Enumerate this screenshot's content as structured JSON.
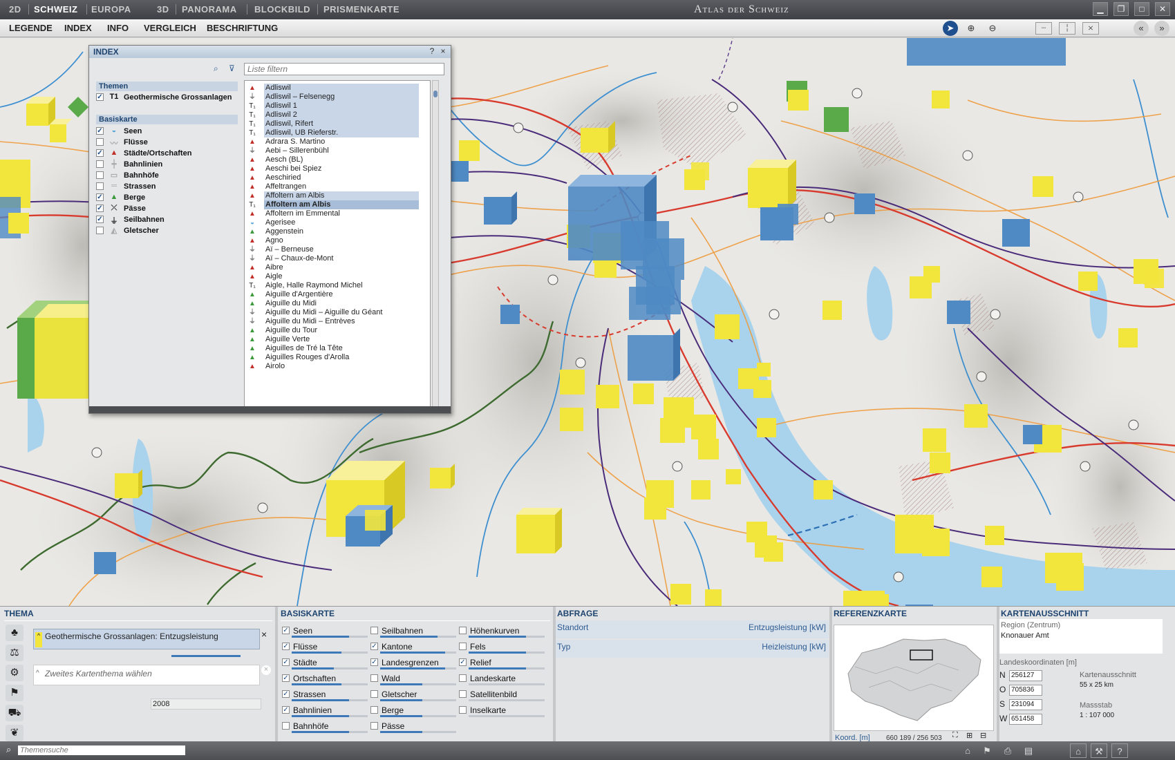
{
  "window": {
    "title": "Atlas der Schweiz",
    "view_tabs": [
      {
        "label": "2D",
        "active": false
      },
      {
        "label": "SCHWEIZ",
        "active": true
      },
      {
        "label": "EUROPA",
        "active": false
      },
      {
        "label": "3D",
        "active": false
      },
      {
        "label": "PANORAMA",
        "active": false
      },
      {
        "label": "BLOCKBILD",
        "active": false
      },
      {
        "label": "PRISMENKARTE",
        "active": false
      }
    ],
    "controls": [
      "minimize-icon",
      "restore-icon",
      "maximize-icon",
      "close-icon"
    ]
  },
  "menu": {
    "items": [
      "LEGENDE",
      "INDEX",
      "INFO",
      "VERGLEICH",
      "BESCHRIFTUNG"
    ],
    "tools": [
      "pointer-icon",
      "zoom-in-icon",
      "zoom-out-icon"
    ],
    "view_tools": [
      "profile-icon",
      "split-view-icon",
      "compare-icon",
      "back-icon",
      "forward-icon"
    ]
  },
  "index_panel": {
    "title": "INDEX",
    "help": "?",
    "close": "×",
    "filter_placeholder": "Liste filtern",
    "themen_header": "Themen",
    "themen": [
      {
        "label": "Geothermische Grossanlagen",
        "checked": true,
        "icon": "T1"
      }
    ],
    "basiskarte_header": "Basiskarte",
    "layers": [
      {
        "label": "Seen",
        "checked": true,
        "icon": "lake-icon"
      },
      {
        "label": "Flüsse",
        "checked": false,
        "icon": "river-icon"
      },
      {
        "label": "Städte/Ortschaften",
        "checked": true,
        "icon": "town-icon"
      },
      {
        "label": "Bahnlinien",
        "checked": false,
        "icon": "rail-icon"
      },
      {
        "label": "Bahnhöfe",
        "checked": false,
        "icon": "station-icon"
      },
      {
        "label": "Strassen",
        "checked": false,
        "icon": "road-icon"
      },
      {
        "label": "Berge",
        "checked": true,
        "icon": "mountain-icon"
      },
      {
        "label": "Pässe",
        "checked": true,
        "icon": "pass-icon"
      },
      {
        "label": "Seilbahnen",
        "checked": true,
        "icon": "cablecar-icon"
      },
      {
        "label": "Gletscher",
        "checked": false,
        "icon": "glacier-icon"
      }
    ],
    "list": [
      {
        "label": "Adliswil",
        "icon": "town",
        "state": "sel"
      },
      {
        "label": "Adliswil – Felsenegg",
        "icon": "cable",
        "state": "sel"
      },
      {
        "label": "Adliswil 1",
        "icon": "T1",
        "state": "sel"
      },
      {
        "label": "Adliswil 2",
        "icon": "T1",
        "state": "sel"
      },
      {
        "label": "Adliswil, Rifert",
        "icon": "T1",
        "state": "sel"
      },
      {
        "label": "Adliswil, UB Rieferstr.",
        "icon": "T1",
        "state": "sel"
      },
      {
        "label": "Adrara S. Martino",
        "icon": "town",
        "state": ""
      },
      {
        "label": "Aebi – Sillerenbühl",
        "icon": "cable",
        "state": ""
      },
      {
        "label": "Aesch (BL)",
        "icon": "town",
        "state": ""
      },
      {
        "label": "Aeschi bei Spiez",
        "icon": "town",
        "state": ""
      },
      {
        "label": "Aeschiried",
        "icon": "town",
        "state": ""
      },
      {
        "label": "Affeltrangen",
        "icon": "town",
        "state": ""
      },
      {
        "label": "Affoltern am Albis",
        "icon": "town",
        "state": "sel"
      },
      {
        "label": "Affoltern am Albis",
        "icon": "T1",
        "state": "cur"
      },
      {
        "label": "Affoltern im Emmental",
        "icon": "town",
        "state": ""
      },
      {
        "label": "Agerisee",
        "icon": "lake",
        "state": ""
      },
      {
        "label": "Aggenstein",
        "icon": "mountain",
        "state": ""
      },
      {
        "label": "Agno",
        "icon": "town",
        "state": ""
      },
      {
        "label": "Aï – Berneuse",
        "icon": "cable",
        "state": ""
      },
      {
        "label": "Aï – Chaux-de-Mont",
        "icon": "cable",
        "state": ""
      },
      {
        "label": "Aibre",
        "icon": "town",
        "state": ""
      },
      {
        "label": "Aigle",
        "icon": "town",
        "state": ""
      },
      {
        "label": "Aigle, Halle Raymond Michel",
        "icon": "T1",
        "state": ""
      },
      {
        "label": "Aiguille d'Argentière",
        "icon": "mountain",
        "state": ""
      },
      {
        "label": "Aiguille du Midi",
        "icon": "mountain",
        "state": ""
      },
      {
        "label": "Aiguille du Midi – Aiguille du Géant",
        "icon": "cable",
        "state": ""
      },
      {
        "label": "Aiguille du Midi – Entrèves",
        "icon": "cable",
        "state": ""
      },
      {
        "label": "Aiguille du Tour",
        "icon": "mountain",
        "state": ""
      },
      {
        "label": "Aiguille Verte",
        "icon": "mountain",
        "state": ""
      },
      {
        "label": "Aiguilles de Tré la Tête",
        "icon": "mountain",
        "state": ""
      },
      {
        "label": "Aiguilles Rouges d'Arolla",
        "icon": "mountain",
        "state": ""
      },
      {
        "label": "Airolo",
        "icon": "town",
        "state": ""
      }
    ]
  },
  "thema": {
    "header": "THEMA",
    "primary_theme": "Geothermische Grossanlagen: Entzugsleistung",
    "secondary_placeholder": "Zweites Kartenthema wählen",
    "year": "2008",
    "side_icons": [
      "nature-icon",
      "society-icon",
      "economy-icon",
      "state-icon",
      "traffic-icon",
      "energy-icon"
    ]
  },
  "basiskarte": {
    "header": "BASISKARTE",
    "columns": [
      [
        {
          "label": "Seen",
          "checked": true,
          "slider": 0.75
        },
        {
          "label": "Flüsse",
          "checked": true,
          "slider": 0.65
        },
        {
          "label": "Städte",
          "checked": true,
          "slider": 0.55
        },
        {
          "label": "Ortschaften",
          "checked": true,
          "slider": 0.65
        },
        {
          "label": "Strassen",
          "checked": true,
          "slider": 0.75
        },
        {
          "label": "Bahnlinien",
          "checked": true,
          "slider": 0.75
        },
        {
          "label": "Bahnhöfe",
          "checked": false,
          "slider": 0.75
        }
      ],
      [
        {
          "label": "Seilbahnen",
          "checked": false,
          "slider": 0.75
        },
        {
          "label": "Kantone",
          "checked": true,
          "slider": 0.85
        },
        {
          "label": "Landesgrenzen",
          "checked": true,
          "slider": 0.85
        },
        {
          "label": "Wald",
          "checked": false,
          "slider": 0.55
        },
        {
          "label": "Gletscher",
          "checked": false,
          "slider": 0.55
        },
        {
          "label": "Berge",
          "checked": false,
          "slider": 0.55
        },
        {
          "label": "Pässe",
          "checked": false,
          "slider": 0.55
        }
      ],
      [
        {
          "label": "Höhenkurven",
          "checked": false,
          "slider": 0.75
        },
        {
          "label": "Fels",
          "checked": false,
          "slider": 0.75
        },
        {
          "label": "Relief",
          "checked": true,
          "slider": 0.75
        },
        {
          "label": "Landeskarte",
          "checked": false,
          "slider": 0.0
        },
        {
          "label": "Satellitenbild",
          "checked": false,
          "slider": 0.0
        },
        {
          "label": "Inselkarte",
          "checked": false,
          "slider": 0.0
        }
      ]
    ]
  },
  "abfrage": {
    "header": "ABFRAGE",
    "rows": [
      {
        "left": "Standort",
        "right": "Entzugsleistung [kW]"
      },
      {
        "left": "Typ",
        "right": "Heizleistung [kW]"
      }
    ]
  },
  "referenzkarte": {
    "header": "REFERENZKARTE",
    "coord_label": "Koord. [m]",
    "coord_value": "660 189 / 256 503"
  },
  "kartenausschnitt": {
    "header": "KARTENAUSSCHNITT",
    "region_label": "Region (Zentrum)",
    "region_value": "Knonauer Amt",
    "coords_header": "Landeskoordinaten [m]",
    "coords": [
      {
        "label": "N",
        "value": "256127"
      },
      {
        "label": "O",
        "value": "705836"
      },
      {
        "label": "S",
        "value": "231094"
      },
      {
        "label": "W",
        "value": "651458"
      }
    ],
    "extent_label": "Kartenausschnitt",
    "extent_value": "55 x 25 km",
    "scale_label": "Massstab",
    "scale_value": "1 : 107 000"
  },
  "statusbar": {
    "search_placeholder": "Themensuche",
    "icons": [
      "home-icon",
      "bookmark-icon",
      "print-icon",
      "map-folder-icon",
      "house-icon",
      "tools-icon",
      "help-icon"
    ]
  },
  "colors": {
    "cube_yellow": "#f2e53c",
    "cube_blue": "#4f8ac4",
    "cube_green": "#5aaa4a",
    "lake": "#a9d3ec",
    "accent": "#1e4470"
  }
}
